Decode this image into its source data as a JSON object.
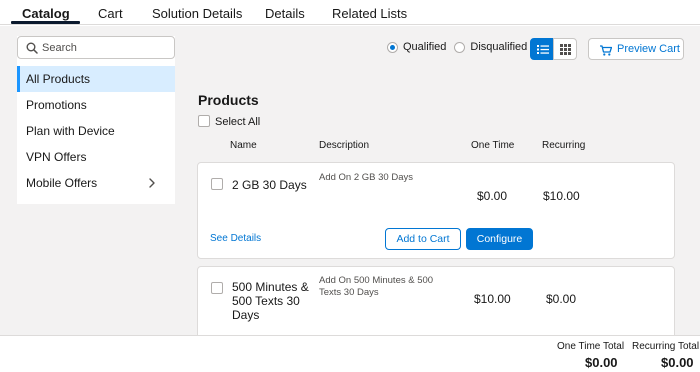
{
  "tabs": [
    {
      "label": "Catalog",
      "active": true
    },
    {
      "label": "Cart"
    },
    {
      "label": "Solution Details"
    },
    {
      "label": "Details"
    },
    {
      "label": "Related Lists"
    }
  ],
  "sidebar": {
    "search_placeholder": "Search",
    "items": [
      {
        "label": "All Products",
        "active": true
      },
      {
        "label": "Promotions"
      },
      {
        "label": "Plan with Device"
      },
      {
        "label": "VPN Offers"
      },
      {
        "label": "Mobile Offers",
        "has_children": true
      }
    ]
  },
  "toolbar": {
    "qualified_label": "Qualified",
    "disqualified_label": "Disqualified",
    "selected_filter": "Qualified",
    "view_mode": "list",
    "preview_cart_label": "Preview Cart"
  },
  "products": {
    "title": "Products",
    "select_all_label": "Select All",
    "columns": {
      "name": "Name",
      "description": "Description",
      "one_time": "One Time",
      "recurring": "Recurring"
    },
    "items": [
      {
        "name": "2 GB 30 Days",
        "description": "Add On 2 GB 30 Days",
        "one_time": "$0.00",
        "recurring": "$10.00",
        "see_details": "See Details",
        "add_to_cart": "Add to Cart",
        "configure": "Configure"
      },
      {
        "name": "500 Minutes & 500 Texts 30 Days",
        "description": "Add On 500 Minutes & 500 Texts 30 Days",
        "one_time": "$10.00",
        "recurring": "$0.00"
      }
    ]
  },
  "totals": {
    "one_time_label": "One Time Total",
    "one_time_value": "$0.00",
    "recurring_label": "Recurring Total",
    "recurring_value": "$0.00"
  },
  "colors": {
    "brand": "#0176d3",
    "selected_nav_bg": "#d8edff",
    "selected_nav_bar": "#1b96ff",
    "page_bg": "#f3f2f2"
  }
}
